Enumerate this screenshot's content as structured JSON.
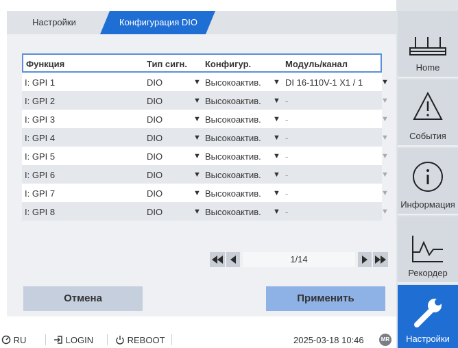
{
  "tabs": {
    "settings_label": "Настройки",
    "dio_label": "Конфигурация DIO"
  },
  "table": {
    "headers": {
      "function": "Функция",
      "signal_type": "Тип сигн.",
      "config": "Конфигур.",
      "module": "Модуль/канал"
    },
    "rows": [
      {
        "function": "I: GPI 1",
        "signal_type": "DIO",
        "config": "Высокоактив.",
        "module": "DI 16-110V-1 X1 / 1"
      },
      {
        "function": "I: GPI 2",
        "signal_type": "DIO",
        "config": "Высокоактив.",
        "module": "-"
      },
      {
        "function": "I: GPI 3",
        "signal_type": "DIO",
        "config": "Высокоактив.",
        "module": "-"
      },
      {
        "function": "I: GPI 4",
        "signal_type": "DIO",
        "config": "Высокоактив.",
        "module": "-"
      },
      {
        "function": "I: GPI 5",
        "signal_type": "DIO",
        "config": "Высокоактив.",
        "module": "-"
      },
      {
        "function": "I: GPI 6",
        "signal_type": "DIO",
        "config": "Высокоактив.",
        "module": "-"
      },
      {
        "function": "I: GPI 7",
        "signal_type": "DIO",
        "config": "Высокоактив.",
        "module": "-"
      },
      {
        "function": "I: GPI 8",
        "signal_type": "DIO",
        "config": "Высокоактив.",
        "module": "-"
      }
    ],
    "dropdown_arrow": "▼"
  },
  "pager": {
    "page_text": "1/14"
  },
  "buttons": {
    "cancel": "Отмена",
    "apply": "Применить"
  },
  "footer": {
    "language": "RU",
    "login": "LOGIN",
    "reboot": "REBOOT",
    "datetime": "2025-03-18 10:46",
    "logo_text": "MR"
  },
  "nav": {
    "home": "Home",
    "events": "События",
    "info": "Информация",
    "recorder": "Рекордер",
    "settings": "Настройки"
  },
  "colors": {
    "accent": "#1f6ed4",
    "apply_button": "#8fb2e6",
    "cancel_button": "#c5cfdd"
  }
}
